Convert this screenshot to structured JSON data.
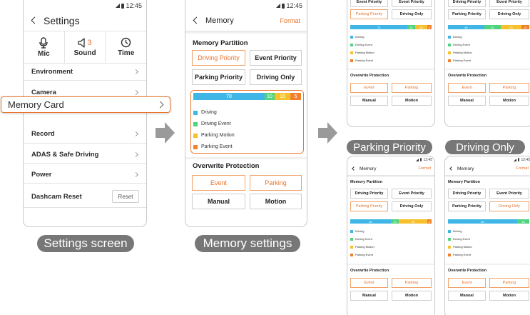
{
  "status": {
    "time": "12:45"
  },
  "settings_screen": {
    "title": "Settings",
    "quick": [
      {
        "label": "Mic",
        "icon": "microphone-icon"
      },
      {
        "label": "Sound",
        "icon": "speaker-icon",
        "value": "3"
      },
      {
        "label": "Time",
        "icon": "clock-icon"
      }
    ],
    "menu": [
      "Environment",
      "Camera",
      "Memory Card",
      "Record",
      "ADAS & Safe Driving",
      "Power",
      "Dashcam Reset"
    ],
    "reset_label": "Reset",
    "caption": "Settings screen"
  },
  "memory_screen": {
    "title": "Memory",
    "format_label": "Format",
    "partition_title": "Memory Partition",
    "partition_options": [
      "Driving Priority",
      "Event Priority",
      "Parking Priority",
      "Driving Only"
    ],
    "usage_bar": [
      "70",
      "10",
      "15",
      "5"
    ],
    "legend": [
      "Driving",
      "Driving Event",
      "Parking Motion",
      "Parking Event"
    ],
    "overwrite_title": "Overwrite Protection",
    "overwrite_options": [
      "Event",
      "Parking",
      "Manual",
      "Motion"
    ],
    "caption": "Memory settings"
  },
  "variants": {
    "top_left": {
      "bar": [
        "70",
        "10",
        "15",
        "5"
      ],
      "legend": [
        "Driving",
        "Driving Event",
        "Parking Motion",
        "Parking Event"
      ]
    },
    "top_right": {
      "bar": [
        "45",
        "20",
        "25",
        "10"
      ],
      "legend": [
        "Driving",
        "Driving Event",
        "Parking Motion",
        "Parking Event"
      ]
    },
    "parking_priority": {
      "caption": "Parking Priority",
      "bar": [
        "50",
        "10",
        "35",
        "5"
      ]
    },
    "driving_only": {
      "caption": "Driving Only",
      "bar": [
        "85",
        "15"
      ]
    }
  },
  "colors": {
    "accent": "#e8742d",
    "driving": "#3fb6e6",
    "driving_event": "#4fd47e",
    "parking_motion": "#f6c12c",
    "parking_event": "#f0812a",
    "caption_bg": "#777777"
  },
  "memory_distribution": {
    "memory_settings": {
      "driving": 70,
      "driving_event": 10,
      "parking_motion": 15,
      "parking_event": 5
    },
    "top_left": {
      "driving": 70,
      "driving_event": 10,
      "parking_motion": 15,
      "parking_event": 5
    },
    "top_right": {
      "driving": 45,
      "driving_event": 20,
      "parking_motion": 25,
      "parking_event": 10
    },
    "parking_priority": {
      "driving": 50,
      "driving_event": 10,
      "parking_motion": 35,
      "parking_event": 5
    },
    "driving_only": {
      "driving": 85,
      "driving_event": 15
    }
  }
}
